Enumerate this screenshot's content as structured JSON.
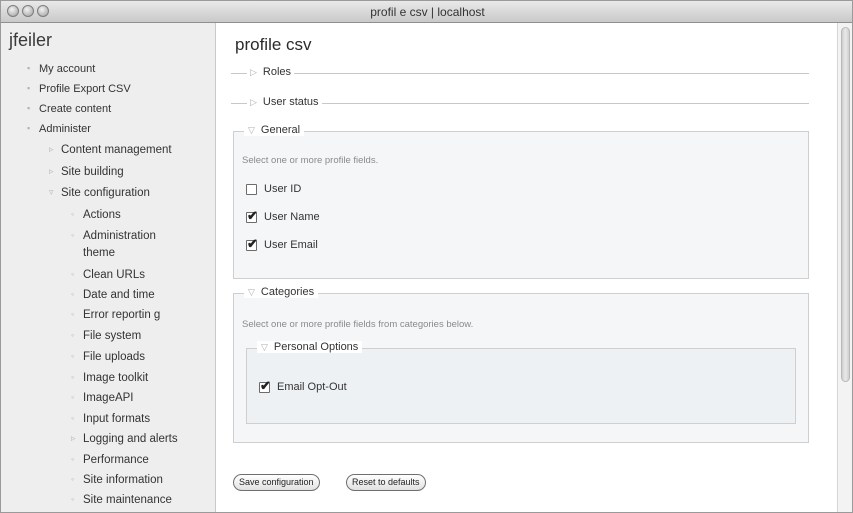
{
  "window": {
    "title": "profil e csv | localhost"
  },
  "sidebar": {
    "user": "jfeiler",
    "items": [
      {
        "label": "My account"
      },
      {
        "label": "Profile Export CSV"
      },
      {
        "label": "Create content"
      },
      {
        "label": "Administer"
      },
      {
        "label": "Content management"
      },
      {
        "label": "Site building"
      },
      {
        "label": "Site configuration"
      },
      {
        "label": "Actions"
      },
      {
        "label": "Administration"
      },
      {
        "label": "theme"
      },
      {
        "label": "Clean URLs"
      },
      {
        "label": "Date and time"
      },
      {
        "label": "Error reportin g"
      },
      {
        "label": "File system"
      },
      {
        "label": "File uploads"
      },
      {
        "label": "Image toolkit"
      },
      {
        "label": "ImageAPI"
      },
      {
        "label": "Input formats"
      },
      {
        "label": "Logging and alerts"
      },
      {
        "label": "Performance"
      },
      {
        "label": "Site information"
      },
      {
        "label": "Site maintenance"
      }
    ]
  },
  "main": {
    "title": "profile csv",
    "collapsed": [
      {
        "label": "Roles"
      },
      {
        "label": "User status"
      }
    ],
    "general": {
      "legend": "General",
      "description": "Select one or more profile fields.",
      "fields": [
        {
          "label": "User ID",
          "checked": false
        },
        {
          "label": "User Name",
          "checked": true
        },
        {
          "label": "User Email",
          "checked": true
        }
      ]
    },
    "categories": {
      "legend": "Categories",
      "description": "Select one or more profile fields from categories below.",
      "personal": {
        "legend": "Personal Options",
        "fields": [
          {
            "label": "Email Opt-Out",
            "checked": true
          }
        ]
      }
    },
    "buttons": {
      "save": "Save configuration",
      "reset": "Reset to defaults"
    }
  }
}
